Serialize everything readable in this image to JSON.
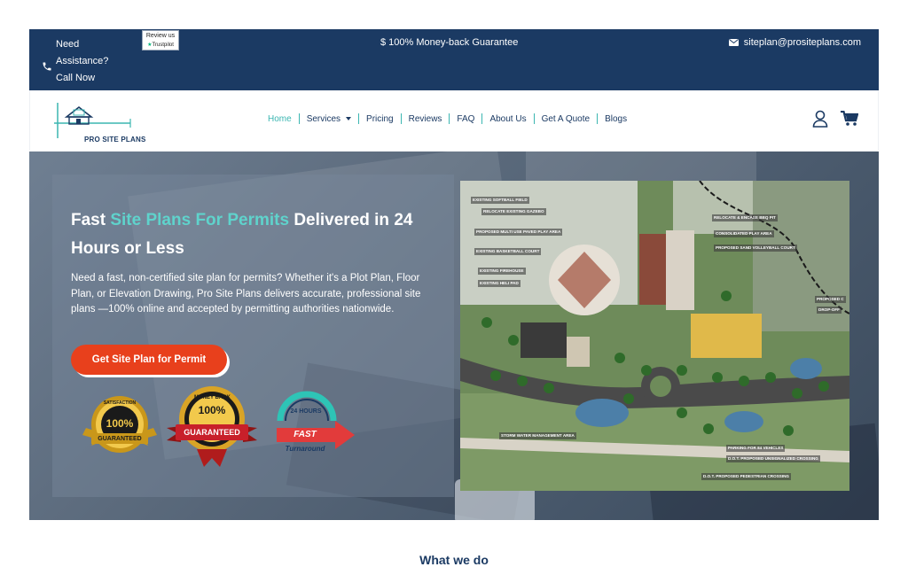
{
  "topbar": {
    "assist_line1": "Need",
    "assist_line2": "Assistance?",
    "assist_line3": "Call Now",
    "trustpilot_review": "Review us",
    "trustpilot_brand": "Trustpilot",
    "guarantee": "$  100% Money-back Guarantee",
    "email": "siteplan@prositeplans.com",
    "colors": {
      "background": "#1b3a63",
      "text": "#ffffff"
    }
  },
  "nav": {
    "logo_text": "PRO SITE PLANS",
    "items": [
      {
        "label": "Home",
        "active": true
      },
      {
        "label": "Services",
        "has_dropdown": true
      },
      {
        "label": "Pricing"
      },
      {
        "label": "Reviews"
      },
      {
        "label": "FAQ"
      },
      {
        "label": "About Us"
      },
      {
        "label": "Get A Quote"
      },
      {
        "label": "Blogs"
      }
    ],
    "icons": [
      "user-icon",
      "cart-icon"
    ],
    "colors": {
      "active": "#3bb6b1",
      "text": "#1b3a63"
    }
  },
  "hero": {
    "title_part1": "Fast ",
    "title_highlight": "Site Plans For Permits",
    "title_part2": " Delivered in 24 Hours or Less",
    "description": "Need a fast, non-certified site plan for permits? Whether it's a Plot Plan, Floor Plan, or Elevation Drawing, Pro Site Plans delivers accurate, professional site plans —100% online and accepted by permitting authorities nationwide.",
    "cta_label": "Get Site Plan for Permit",
    "badges": {
      "satisfaction_top": "SATISFACTION",
      "satisfaction_100": "100%",
      "satisfaction_bottom": "GUARANTEED",
      "money_back": "MONEY BACK",
      "money_100": "100%",
      "money_ribbon": "GUARANTEED",
      "fast_hours": "24 HOURS",
      "fast_label": "FAST",
      "fast_sub": "Turnaround"
    },
    "colors": {
      "highlight": "#5fd3cc",
      "cta": "#e8401c"
    },
    "site_plan_labels": [
      "EXISTING SOFTBALL FIELD",
      "RELOCATE EXISTING GAZEBO",
      "PROPOSED MULTI USE PAVED PLAY AREA",
      "EXISTING BASKETBALL COURT",
      "EXISTING FIREHOUSE",
      "EXISTING HELI PAD",
      "RELOCATE & ENCASE BBQ PIT",
      "CONSOLIDATED PLAY AREA",
      "PROPOSED SAND VOLLEYBALL COURT",
      "PROPOSED C",
      "DROP-OFF",
      "STORM WATER MANAGEMENT AREA",
      "PARKING FOR 84 VEHICLES",
      "D.O.T. PROPOSED UNSIGNALIZED CROSSING",
      "D.O.T. PROPOSED PEDESTRIAN CROSSING"
    ]
  },
  "section": {
    "heading": "What we do"
  }
}
